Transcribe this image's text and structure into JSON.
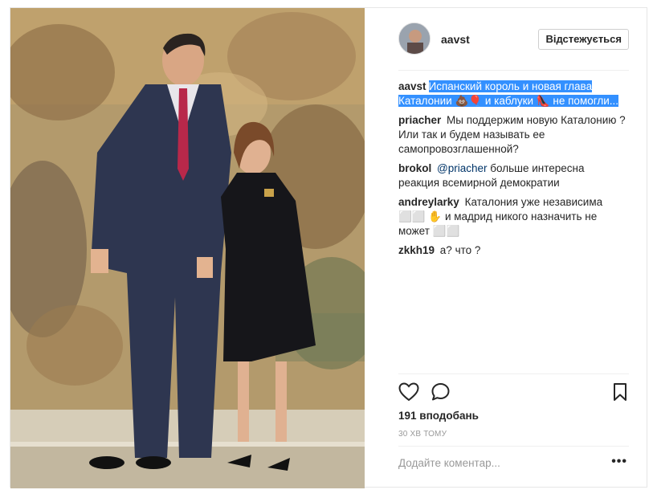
{
  "post": {
    "username": "aavst",
    "follow_button": "Відстежується",
    "likes": "191 вподобань",
    "time": "30 ХВ ТОМУ",
    "comment_placeholder": "Додайте коментар...",
    "more_icon": "more-options-icon"
  },
  "caption": {
    "user": "aavst",
    "text_1": "Испанский король и новая глава Каталонии",
    "emoji_1": "💩🎈",
    "text_2": "и каблуки",
    "emoji_2": "👠",
    "text_3": "не помогли..."
  },
  "comments": [
    {
      "user": "priacher",
      "text": "Мы поддержим новую Каталонию ? Или так и будем называть ее самопровозглашенной?"
    },
    {
      "user": "brokol",
      "mention": "@priacher",
      "text": "больше интересна реакция всемирной демократии"
    },
    {
      "user": "andreylarky",
      "text_1": "Каталония уже независима ⬜⬜",
      "emoji": "✋",
      "text_2": "и мадрид никого назначить не может ⬜⬜"
    },
    {
      "user": "zkkh19",
      "text": "а? что ?"
    }
  ],
  "icons": {
    "like": "heart-icon",
    "comment": "comment-icon",
    "save": "bookmark-icon"
  },
  "colors": {
    "selection": "#3390ff",
    "mention": "#003569",
    "muted": "#999999",
    "border": "#efefef"
  }
}
